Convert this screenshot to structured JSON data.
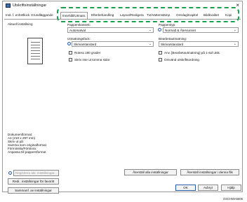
{
  "window": {
    "title": "Utskriftsinställningar",
    "close_glyph": "×"
  },
  "tabs": [
    "Inst. f. enhetlkick",
    "Grundläggande",
    "Innehåll/Utmatn.",
    "Efterbehandling",
    "Layout/Redigera",
    "Txt/Vattenstämp",
    "Omslag/Kapitel",
    "Bildkvalitet",
    "Kopi"
  ],
  "left": {
    "current_label": "Aktuell inställning",
    "doc_info": [
      "Dokumentformat:",
      "  A4 (210 x 297 mm)",
      "Skriv ut på:",
      "  Samma som originalformat",
      "Förminska/Förstora:",
      "  Anpassa till pappersformat"
    ],
    "register_btn": "Registrera akt. inställningar...",
    "edit_btn": "Redi.. inställningar för favoritt",
    "summary_btn": "Sammanf. av inställningar"
  },
  "right": {
    "paper_tray_label": "Papperskassett:",
    "paper_tray_value": "Automatval",
    "paper_type_label": "Papperstyp:",
    "paper_type_value": "Normalt & Återvunnet",
    "output_tray_label": "Utmatningsfack:",
    "output_tray_value": "Skrivarstandard",
    "cover_label": "Bearbetautmatning:",
    "cover_value": "Skrivarstandard",
    "rotate_label": "Rotera 180 grader",
    "blank_label": "Skriv inte ut tomma sidor",
    "use_label": "Anv. [Bearbetautmatning] på 1-sid utsk.",
    "reverse_label": "Omvänd utskriftsordning"
  },
  "bottom": {
    "restore_btn": "Återställ alla inställningar",
    "restore_tab_btn": "Återställ inställningar i denna flik",
    "ok_btn": "OK",
    "cancel_btn": "Avbryt",
    "help_btn": "Hjälp",
    "caption": "DSCHWA5605"
  },
  "colors": {
    "highlight": "#1aa04a",
    "info": "#2a5aa8"
  }
}
